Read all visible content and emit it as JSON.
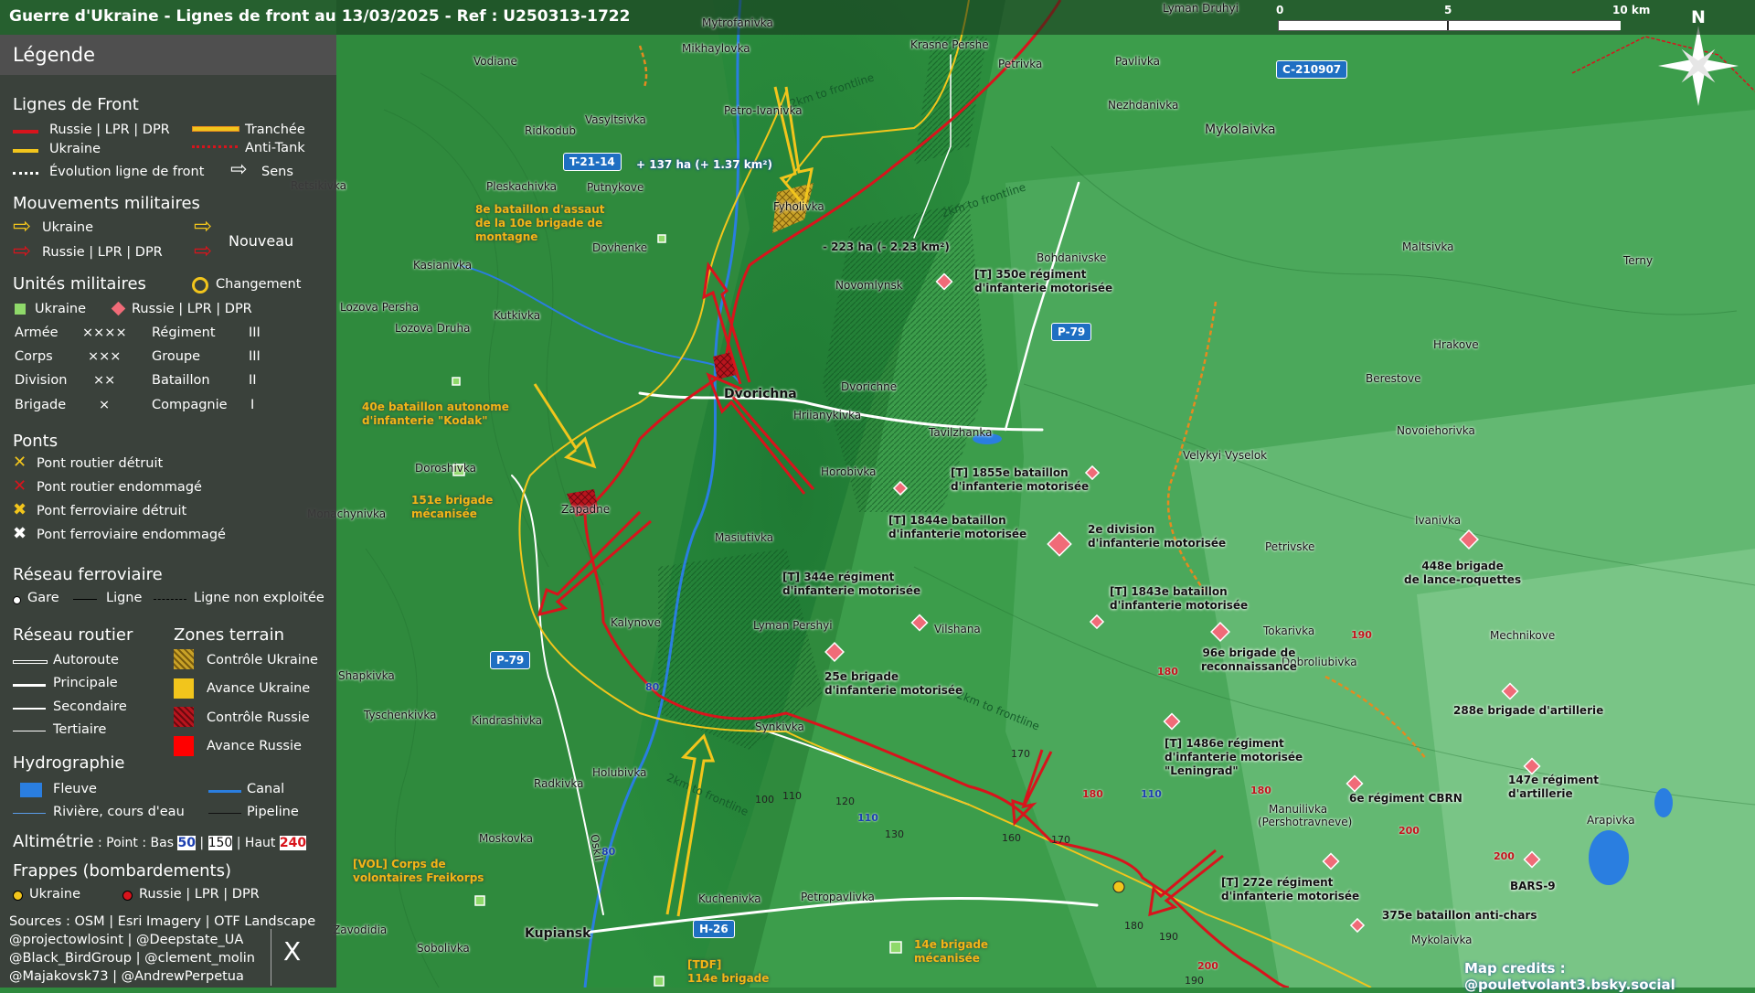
{
  "title": "Guerre d'Ukraine - Lignes de front au 13/03/2025 - Ref : U250313-1722",
  "scale": {
    "labels": [
      "0",
      "5",
      "10 km"
    ]
  },
  "north_label": "N",
  "colors": {
    "russia": "#d8141c",
    "ukraine": "#f2c51c",
    "water": "#2a7ee0",
    "panel": "#3a3a3a"
  },
  "legend": {
    "header": "Légende",
    "front_lines": {
      "title": "Lignes de Front",
      "russia": "Russie | LPR | DPR",
      "ukraine": "Ukraine",
      "trench": "Tranchée",
      "antitank": "Anti-Tank",
      "evolution": "Évolution ligne de front",
      "direction": "Sens"
    },
    "movements": {
      "title": "Mouvements militaires",
      "ukraine": "Ukraine",
      "russia": "Russie | LPR | DPR",
      "new": "Nouveau"
    },
    "units": {
      "title": "Unités militaires",
      "change": "Changement",
      "ukraine": "Ukraine",
      "russia": "Russie | LPR | DPR",
      "rows": [
        {
          "a": "Armée",
          "as": "××××",
          "b": "Régiment",
          "bs": "III"
        },
        {
          "a": "Corps",
          "as": "×××",
          "b": "Groupe",
          "bs": "III"
        },
        {
          "a": "Division",
          "as": "××",
          "b": "Bataillon",
          "bs": "II"
        },
        {
          "a": "Brigade",
          "as": "×",
          "b": "Compagnie",
          "bs": "I"
        }
      ]
    },
    "bridges": {
      "title": "Ponts",
      "items": [
        "Pont routier détruit",
        "Pont routier endommagé",
        "Pont ferroviaire détruit",
        "Pont ferroviaire endommagé"
      ]
    },
    "railway": {
      "title": "Réseau ferroviaire",
      "station": "Gare",
      "line": "Ligne",
      "unused": "Ligne non exploitée"
    },
    "roads": {
      "title": "Réseau routier",
      "items": [
        "Autoroute",
        "Principale",
        "Secondaire",
        "Tertiaire"
      ]
    },
    "zones": {
      "title": "Zones terrain",
      "items": [
        "Contrôle Ukraine",
        "Avance Ukraine",
        "Contrôle Russie",
        "Avance Russie"
      ]
    },
    "hydro": {
      "title": "Hydrographie",
      "river_big": "Fleuve",
      "river": "Rivière, cours d'eau",
      "canal": "Canal",
      "pipeline": "Pipeline"
    },
    "altimetry": {
      "title": "Altimétrie",
      "text_a": " : Point : Bas ",
      "low": "50",
      "sep": " | ",
      "mid": "150",
      "text_b": " | Haut ",
      "high": "240"
    },
    "strikes": {
      "title": "Frappes (bombardements)",
      "ukraine": "Ukraine",
      "russia": "Russie | LPR | DPR"
    },
    "sources": [
      "Sources : OSM | Esri Imagery | OTF Landscape",
      "@projectowlosint | @Deepstate_UA",
      "@Black_BirdGroup | @clement_molin",
      "@Majakovsk73 | @AndrewPerpetua"
    ],
    "x_logo": "X"
  },
  "map_credits": "Map credits : @pouletvolant3.bsky.social",
  "road_badges": [
    "T-21-14",
    "C-210907",
    "P-79",
    "P-79",
    "H-26"
  ],
  "area_changes": {
    "gain": "+ 137 ha (+ 1.37 km²)",
    "loss": "- 223 ha (- 2.23 km²)"
  },
  "frontline_notes": [
    "2km to frontline",
    "2km to frontline",
    "2km to frontline",
    "2km to frontline"
  ],
  "places": [
    "Mytrofanivka",
    "Lyman Druhyi",
    "Vodiane",
    "Mikhaylovka",
    "Krasne Pershe",
    "Petrivka",
    "Pavlivka",
    "Nezhdanivka",
    "Mykolaivka",
    "Vasyltsivka",
    "Petro-Ivanivka",
    "Ridkodub",
    "Putnykove",
    "Fyholivka",
    "Pleskachivka",
    "Dovhenke",
    "Bohdanivske",
    "Maltsivka",
    "Terny",
    "Kasianivka",
    "Novomlynsk",
    "Lozova Persha",
    "Kutkivka",
    "Lozova Druha",
    "Hrakove",
    "Berestove",
    "Dvorichna",
    "Dvorichne",
    "Hriianykivka",
    "Tavilzhanka",
    "Novoiehorivka",
    "Doroshivka",
    "Horobivka",
    "Velykyi Vyselok",
    "Monachynivka",
    "Zapadne",
    "Masiutivka",
    "Ivanivka",
    "Petrivske",
    "Kalynove",
    "Lyman Pershyi",
    "Vilshana",
    "Tokarivka",
    "Mechnikove",
    "Dobroliubivka",
    "Shapkivka",
    "Tyschenkivka",
    "Kindrashivka",
    "Synkivka",
    "Radkivka",
    "Holubivka",
    "Manuilivka",
    "(Pershotravneve)",
    "Arapivka",
    "Moskovka",
    "Oskil",
    "Kuchenivka",
    "Petropavlivka",
    "Kupiansk",
    "Sobolivka",
    "Mykolaivka",
    "Retsikivka",
    "Zavodidia"
  ],
  "ua_units": [
    "8e bataillon d'assaut|de la 10e brigade de|montagne",
    "40e bataillon autonome|d'infanterie \"Kodak\"",
    "151e brigade|mécanisée",
    "[VOL] Corps de|volontaires Freikorps",
    "14e brigade|mécanisée",
    "[TDF]|114e brigade"
  ],
  "ru_units": [
    "[T] 350e régiment|d'infanterie motorisée",
    "[T] 1855e bataillon|d'infanterie motorisée",
    "[T] 1844e bataillon|d'infanterie motorisée",
    "2e division|d'infanterie motorisée",
    "[T] 344e régiment|d'infanterie motorisée",
    "[T] 1843e bataillon|d'infanterie motorisée",
    "448e brigade|de lance-roquettes",
    "96e brigade de|reconnaissance",
    "25e brigade|d'infanterie motorisée",
    "288e brigade d'artillerie",
    "[T] 1486e régiment|d'infanterie motorisée|\"Leningrad\"",
    "147e régiment|d'artillerie",
    "6e régiment CBRN",
    "[T] 272e régiment|d'infanterie motorisée",
    "BARS-9",
    "375e bataillon anti-chars"
  ],
  "elevations": {
    "red": [
      "190",
      "180",
      "180",
      "180",
      "200",
      "200",
      "200"
    ],
    "blue": [
      "80",
      "110",
      "110",
      "80"
    ],
    "normal": [
      "170",
      "100",
      "110",
      "120",
      "130",
      "160",
      "170",
      "180",
      "190",
      "190"
    ]
  }
}
